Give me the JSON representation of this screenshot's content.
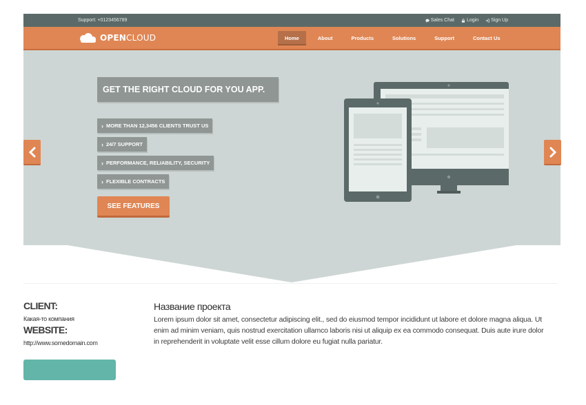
{
  "topbar": {
    "support": "Support: +0123456789",
    "links": [
      {
        "label": "Sales Chat",
        "icon": "chat-icon"
      },
      {
        "label": "Login",
        "icon": "lock-icon"
      },
      {
        "label": "Sign Up",
        "icon": "sign-in-icon"
      }
    ]
  },
  "brand": {
    "part1": "OPEN",
    "part2": "CLOUD",
    "icon": "cloud-icon"
  },
  "menu": {
    "items": [
      "Home",
      "About",
      "Products",
      "Solutions",
      "Support",
      "Contact Us"
    ],
    "active": "Home"
  },
  "hero": {
    "headline": "GET THE RIGHT CLOUD FOR YOU APP.",
    "features": [
      "MORE THAN 12,3456 CLIENTS TRUST US",
      "24/7 SUPPORT",
      "PERFORMANCE, RELIABILITY, SECURITY",
      "FLEXIBLE CONTRACTS"
    ],
    "cta": "SEE FEATURES",
    "prev_icon": "chevron-left-icon",
    "next_icon": "chevron-right-icon"
  },
  "info": {
    "client_label": "CLIENT:",
    "client_value": "Какая-то компания",
    "website_label": "WEBSITE:",
    "website_value": "http://www.somedomain.com",
    "project_title": "Название проекта",
    "project_desc": "Lorem ipsum dolor sit amet, consectetur adipiscing elit., sed do eiusmod tempor incididunt ut labore et dolore magna aliqua. Ut enim ad minim veniam, quis nostrud exercitation ullamco laboris nisi ut aliquip ex ea commodo consequat. Duis aute irure dolor in reprehenderit in voluptate velit esse cillum dolore eu fugiat nulla pariatur."
  },
  "colors": {
    "accent": "#e08654",
    "topbar": "#5b6a68",
    "hero_bg": "#cdd6d4",
    "badge": "#8f9694",
    "teal": "#63b5a9"
  }
}
